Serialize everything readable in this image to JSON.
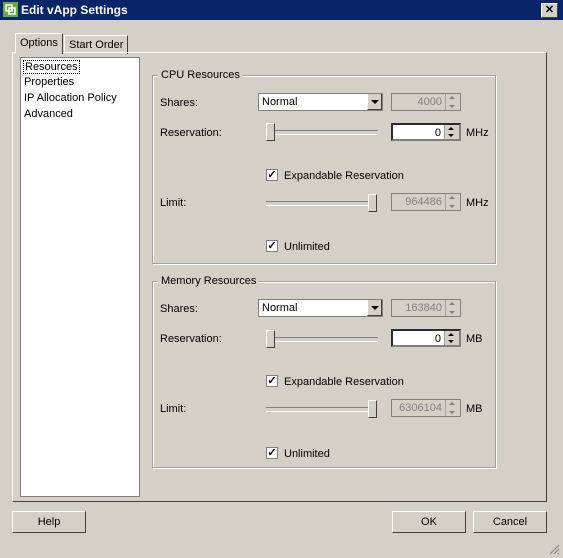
{
  "window": {
    "title": "Edit vApp Settings",
    "close_glyph": "✕"
  },
  "tabs": [
    {
      "label": "Options"
    },
    {
      "label": "Start Order"
    }
  ],
  "nav": {
    "items": [
      {
        "label": "Resources"
      },
      {
        "label": "Properties"
      },
      {
        "label": "IP Allocation Policy"
      },
      {
        "label": "Advanced"
      }
    ]
  },
  "cpu": {
    "title": "CPU Resources",
    "shares_label": "Shares:",
    "shares_value": "Normal",
    "shares_number": "4000",
    "reservation_label": "Reservation:",
    "reservation_value": "0",
    "reservation_unit": "MHz",
    "expandable_label": "Expandable Reservation",
    "expandable_checked": true,
    "limit_label": "Limit:",
    "limit_value": "964486",
    "limit_unit": "MHz",
    "unlimited_label": "Unlimited",
    "unlimited_checked": true
  },
  "memory": {
    "title": "Memory Resources",
    "shares_label": "Shares:",
    "shares_value": "Normal",
    "shares_number": "163840",
    "reservation_label": "Reservation:",
    "reservation_value": "0",
    "reservation_unit": "MB",
    "expandable_label": "Expandable Reservation",
    "expandable_checked": true,
    "limit_label": "Limit:",
    "limit_value": "6306104",
    "limit_unit": "MB",
    "unlimited_label": "Unlimited",
    "unlimited_checked": true
  },
  "footer": {
    "help": "Help",
    "ok": "OK",
    "cancel": "Cancel"
  },
  "colors": {
    "titlebar": "#0a246a",
    "face": "#d4d0c8"
  }
}
